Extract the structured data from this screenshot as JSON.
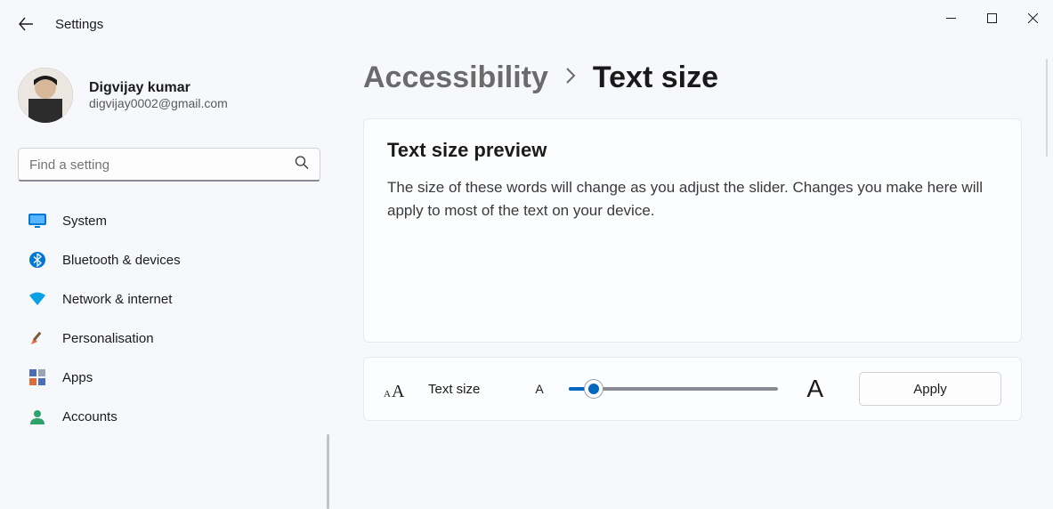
{
  "header": {
    "app_title": "Settings"
  },
  "profile": {
    "name": "Digvijay kumar",
    "email": "digvijay0002@gmail.com"
  },
  "search": {
    "placeholder": "Find a setting"
  },
  "nav": {
    "items": [
      {
        "label": "System",
        "icon": "monitor-icon",
        "color": "#0078d4"
      },
      {
        "label": "Bluetooth & devices",
        "icon": "bluetooth-icon",
        "color": "#0078d4"
      },
      {
        "label": "Network & internet",
        "icon": "wifi-icon",
        "color": "#0aa2e4"
      },
      {
        "label": "Personalisation",
        "icon": "paintbrush-icon",
        "color": "#e06b3a"
      },
      {
        "label": "Apps",
        "icon": "apps-icon",
        "color": "#4a6fb5"
      },
      {
        "label": "Accounts",
        "icon": "person-icon",
        "color": "#2fa36c"
      }
    ]
  },
  "breadcrumb": {
    "parent": "Accessibility",
    "current": "Text size"
  },
  "preview": {
    "title": "Text size preview",
    "body": "The size of these words will change as you adjust the slider. Changes you make here will apply to most of the text on your device."
  },
  "controls": {
    "label": "Text size",
    "small_a": "A",
    "big_a": "A",
    "apply_label": "Apply"
  }
}
